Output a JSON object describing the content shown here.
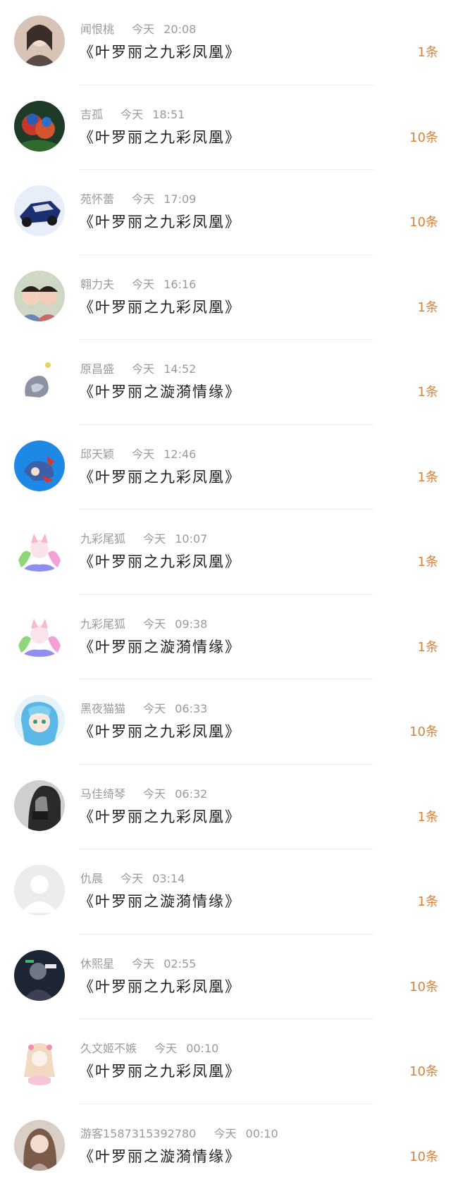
{
  "colors": {
    "count_accent": "#d9833a",
    "meta_text": "#9a9a9a",
    "title_text": "#1f1f1f"
  },
  "items": [
    {
      "name": "闻恨桃",
      "day": "今天",
      "time": "20:08",
      "title": "《叶罗丽之九彩凤凰》",
      "count": "1条",
      "avatar": "avatar-icon"
    },
    {
      "name": "吉孤",
      "day": "今天",
      "time": "18:51",
      "title": "《叶罗丽之九彩凤凰》",
      "count": "10条",
      "avatar": "avatar-icon"
    },
    {
      "name": "苑怀蕾",
      "day": "今天",
      "time": "17:09",
      "title": "《叶罗丽之九彩凤凰》",
      "count": "10条",
      "avatar": "avatar-icon"
    },
    {
      "name": "翱力夫",
      "day": "今天",
      "time": "16:16",
      "title": "《叶罗丽之九彩凤凰》",
      "count": "1条",
      "avatar": "avatar-icon"
    },
    {
      "name": "原昌盛",
      "day": "今天",
      "time": "14:52",
      "title": "《叶罗丽之漩漪情缘》",
      "count": "1条",
      "avatar": "avatar-icon"
    },
    {
      "name": "邱天颖",
      "day": "今天",
      "time": "12:46",
      "title": "《叶罗丽之九彩凤凰》",
      "count": "1条",
      "avatar": "avatar-icon"
    },
    {
      "name": "九彩尾狐",
      "day": "今天",
      "time": "10:07",
      "title": "《叶罗丽之九彩凤凰》",
      "count": "1条",
      "avatar": "avatar-icon"
    },
    {
      "name": "九彩尾狐",
      "day": "今天",
      "time": "09:38",
      "title": "《叶罗丽之漩漪情缘》",
      "count": "1条",
      "avatar": "avatar-icon"
    },
    {
      "name": "黑夜猫猫",
      "day": "今天",
      "time": "06:33",
      "title": "《叶罗丽之九彩凤凰》",
      "count": "10条",
      "avatar": "avatar-icon"
    },
    {
      "name": "马佳绮琴",
      "day": "今天",
      "time": "06:32",
      "title": "《叶罗丽之九彩凤凰》",
      "count": "1条",
      "avatar": "avatar-icon"
    },
    {
      "name": "仇晨",
      "day": "今天",
      "time": "03:14",
      "title": "《叶罗丽之漩漪情缘》",
      "count": "1条",
      "avatar": "avatar-icon"
    },
    {
      "name": "休熙星",
      "day": "今天",
      "time": "02:55",
      "title": "《叶罗丽之九彩凤凰》",
      "count": "10条",
      "avatar": "avatar-icon"
    },
    {
      "name": "久文姬不嫉",
      "day": "今天",
      "time": "00:10",
      "title": "《叶罗丽之九彩凤凰》",
      "count": "10条",
      "avatar": "avatar-icon"
    },
    {
      "name": "游客1587315392780",
      "day": "今天",
      "time": "00:10",
      "title": "《叶罗丽之漩漪情缘》",
      "count": "10条",
      "avatar": "avatar-icon"
    }
  ]
}
